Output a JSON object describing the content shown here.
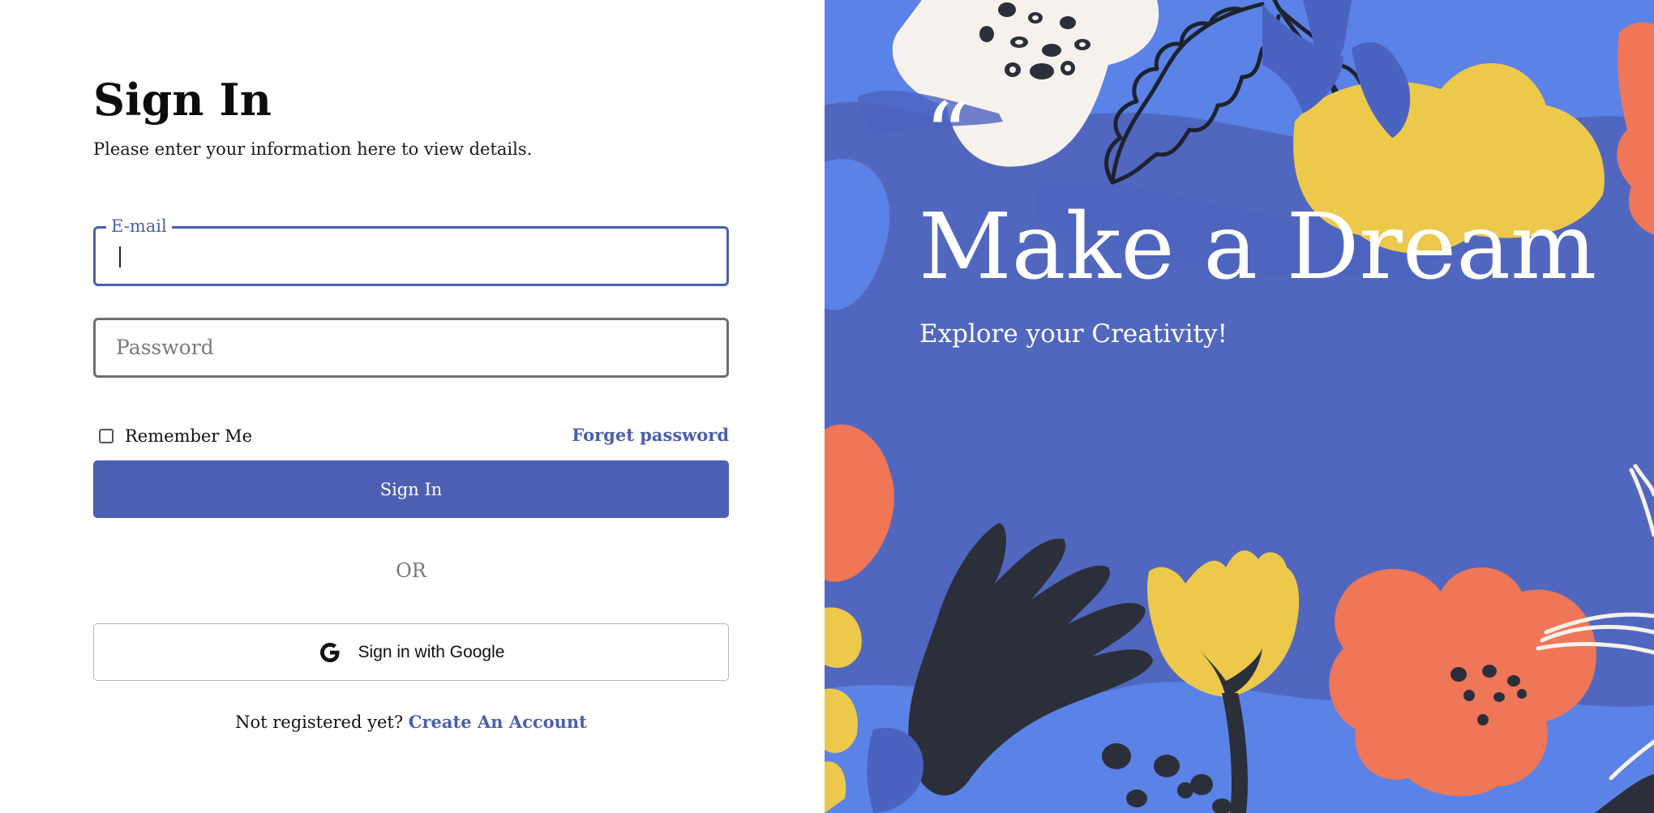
{
  "signin": {
    "title": "Sign In",
    "subtitle": "Please enter your information here to view details.",
    "email_label": "E-mail",
    "email_value": "",
    "password_placeholder": "Password",
    "remember_label": "Remember Me",
    "forgot_label": "Forget password",
    "signin_button": "Sign In",
    "or_label": "OR",
    "google_button": "Sign in with Google",
    "register_prompt": "Not registered yet?",
    "register_link": "Create An Account"
  },
  "hero": {
    "quote_mark": "“",
    "headline": "Make a Dream",
    "tagline": "Explore your Creativity!"
  },
  "colors": {
    "accent": "#4d5fb2",
    "panel_background": "#5167bf",
    "coral": "#ef7656",
    "yellow": "#ecc94b",
    "dark": "#2b2f3a",
    "cream": "#f6f1ec"
  },
  "icons": {
    "google": "google-icon",
    "checkbox": "checkbox-icon"
  }
}
